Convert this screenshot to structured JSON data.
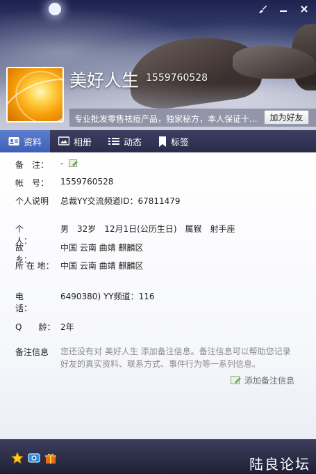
{
  "window": {
    "controls": {
      "skin": "✎",
      "minimize": "▬",
      "close": "✕"
    }
  },
  "profile": {
    "name": "美好人生",
    "uid": "1559760528",
    "signature": "专业批发零售祛痘产品，独家秘方，本人保证十...",
    "add_friend_label": "加为好友"
  },
  "tabs": [
    {
      "label": "资料",
      "icon": "profile-card-icon",
      "active": true
    },
    {
      "label": "相册",
      "icon": "photo-album-icon",
      "active": false
    },
    {
      "label": "动态",
      "icon": "feed-list-icon",
      "active": false
    },
    {
      "label": "标签",
      "icon": "bookmark-tag-icon",
      "active": false
    }
  ],
  "info": {
    "remark": {
      "label": "备　注：",
      "value": "-"
    },
    "account": {
      "label": "帐　号：",
      "value": "1559760528"
    },
    "bio": {
      "label": "个人说明",
      "value": "总裁YY交流频道ID：67811479"
    },
    "person": {
      "label": "个　　人：",
      "value": "男　32岁　12月1日(公历生日)　属猴　射手座"
    },
    "hometown": {
      "label": "故　　乡：",
      "value": "中国 云南 曲靖 麒麟区"
    },
    "location": {
      "label": "所 在 地：",
      "value": "中国 云南 曲靖 麒麟区"
    },
    "phone": {
      "label": "电　　话：",
      "value": "6490380) YY频道：116"
    },
    "q_age": {
      "label": "Q　　龄：",
      "value": "2年"
    },
    "remark_info": {
      "label": "备注信息",
      "line1": "您还没有对 美好人生 添加备注信息。备注信息可以帮助您记录",
      "line2": "好友的真实资料、联系方式、事件行为等一系列信息。",
      "add_label": "添加备注信息"
    }
  },
  "footer": {
    "icons": [
      "star-icon",
      "camera-icon",
      "gift-icon"
    ],
    "watermark": "陆良论坛"
  },
  "colors": {
    "tab_active": "#4a6cc2",
    "tabbar": "#2f3150",
    "footer": "#2b2c47"
  }
}
